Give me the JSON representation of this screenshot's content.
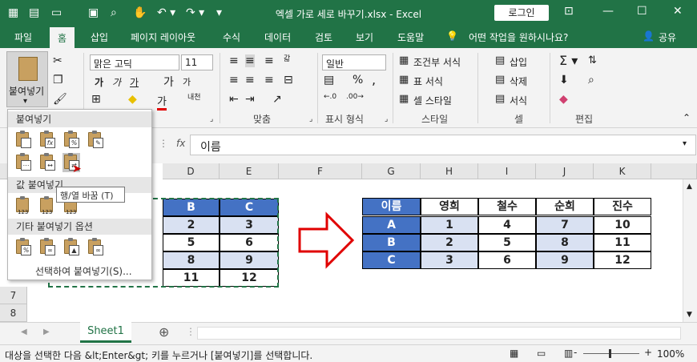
{
  "titlebar": {
    "title": "엑셀 가로 세로 바꾸기.xlsx  -  Excel",
    "login": "로그인"
  },
  "tabs": [
    "파일",
    "홈",
    "삽입",
    "페이지 레이아웃",
    "수식",
    "데이터",
    "검토",
    "보기",
    "도움말"
  ],
  "tell_me": "어떤 작업을 원하시나요?",
  "share": "공유",
  "ribbon": {
    "paste_label": "붙여넣기",
    "font_name": "맑은 고딕",
    "font_size": "11",
    "bold": "가",
    "italic": "가",
    "underline": "가",
    "grow_font": "가",
    "shrink_font": "가",
    "phonetic": "내천",
    "font_color_glyph": "가",
    "align_group": "맞춤",
    "wrap": "갋",
    "number_format": "일반",
    "number_group": "표시 형식",
    "percent": "%",
    "comma": ",",
    "conditional": "조건부 서식",
    "as_table": "표 서식",
    "cell_style": "셀 스타일",
    "style_group": "스타일",
    "insert": "삽입",
    "delete": "삭제",
    "format": "서식",
    "cells_group": "셀",
    "edit_group": "편집"
  },
  "formula": {
    "fx": "fx",
    "value": "이름"
  },
  "columns": [
    "D",
    "E",
    "F",
    "G",
    "H",
    "I",
    "J",
    "K"
  ],
  "rows": [
    "7",
    "8"
  ],
  "source_table": {
    "header": [
      "B",
      "C"
    ],
    "rows": [
      [
        "2",
        "3"
      ],
      [
        "5",
        "6"
      ],
      [
        "8",
        "9"
      ],
      [
        "11",
        "12"
      ]
    ]
  },
  "transposed_table": {
    "header": [
      "이름",
      "영희",
      "철수",
      "순희",
      "진수"
    ],
    "rows": [
      [
        "A",
        "1",
        "4",
        "7",
        "10"
      ],
      [
        "B",
        "2",
        "5",
        "8",
        "11"
      ],
      [
        "C",
        "3",
        "6",
        "9",
        "12"
      ]
    ]
  },
  "paste_menu": {
    "section_paste": "붙여넣기",
    "section_values": "값 붙여넣기",
    "section_other": "기타 붙여넣기 옵션",
    "special": "선택하여 붙여넣기(S)...",
    "values_badge": "123",
    "tooltip": "행/열 바꿈 (T)"
  },
  "sheet": {
    "name": "Sheet1"
  },
  "status": {
    "message": "대상을 선택한 다음 &lt;Enter&gt; 키를 누르거나 [붙여넣기]를 선택합니다.",
    "zoom": "100%",
    "minus": "-",
    "plus": "+"
  },
  "colors": {
    "excel_green": "#217346",
    "header_blue": "#4472c4",
    "light_blue": "#d9e1f2",
    "arrow_red": "#e00000"
  }
}
